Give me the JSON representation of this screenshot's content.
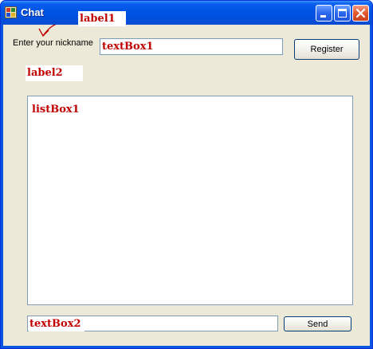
{
  "window": {
    "title": "Chat"
  },
  "labels": {
    "label1": "label1",
    "label2": "label2",
    "nickname_prompt": "Enter your nickname"
  },
  "nickname_box": {
    "value": "textBox1"
  },
  "register_button": {
    "label": "Register"
  },
  "message_list": {
    "items": [
      "listBox1"
    ]
  },
  "message_box": {
    "value": "textBox2"
  },
  "send_button": {
    "label": "Send"
  },
  "colors": {
    "annotation_red": "#c00000",
    "titlebar_blue": "#0055e5",
    "client_bg": "#ece9d8"
  }
}
